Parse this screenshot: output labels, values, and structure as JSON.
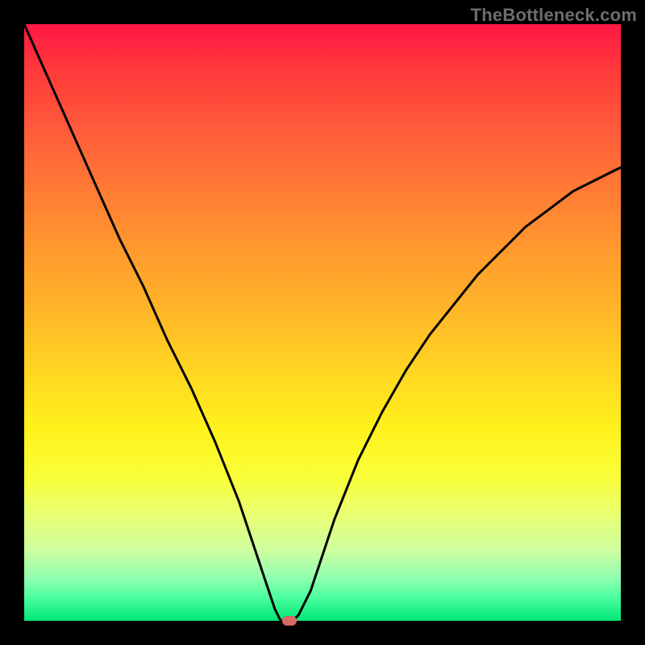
{
  "watermark": "TheBottleneck.com",
  "chart_data": {
    "type": "line",
    "title": "",
    "xlabel": "",
    "ylabel": "",
    "xlim": [
      0,
      100
    ],
    "ylim": [
      0,
      100
    ],
    "grid": false,
    "legend": false,
    "colors": {
      "curve": "#000000",
      "marker": "#d86a66",
      "gradient_top": "#ff1744",
      "gradient_bottom": "#00e676"
    },
    "series": [
      {
        "name": "bottleneck-curve",
        "x": [
          0,
          4,
          8,
          12,
          16,
          20,
          24,
          28,
          32,
          36,
          38,
          40,
          41,
          42,
          43,
          44,
          45,
          46,
          48,
          50,
          52,
          56,
          60,
          64,
          68,
          72,
          76,
          80,
          84,
          88,
          92,
          96,
          100
        ],
        "y": [
          100,
          91,
          82,
          73,
          64,
          56,
          47,
          39,
          30,
          20,
          14,
          8,
          5,
          2,
          0,
          0,
          0,
          1,
          5,
          11,
          17,
          27,
          35,
          42,
          48,
          53,
          58,
          62,
          66,
          69,
          72,
          74,
          76
        ]
      }
    ],
    "marker": {
      "x": 44.5,
      "y": 0
    },
    "annotations": []
  }
}
